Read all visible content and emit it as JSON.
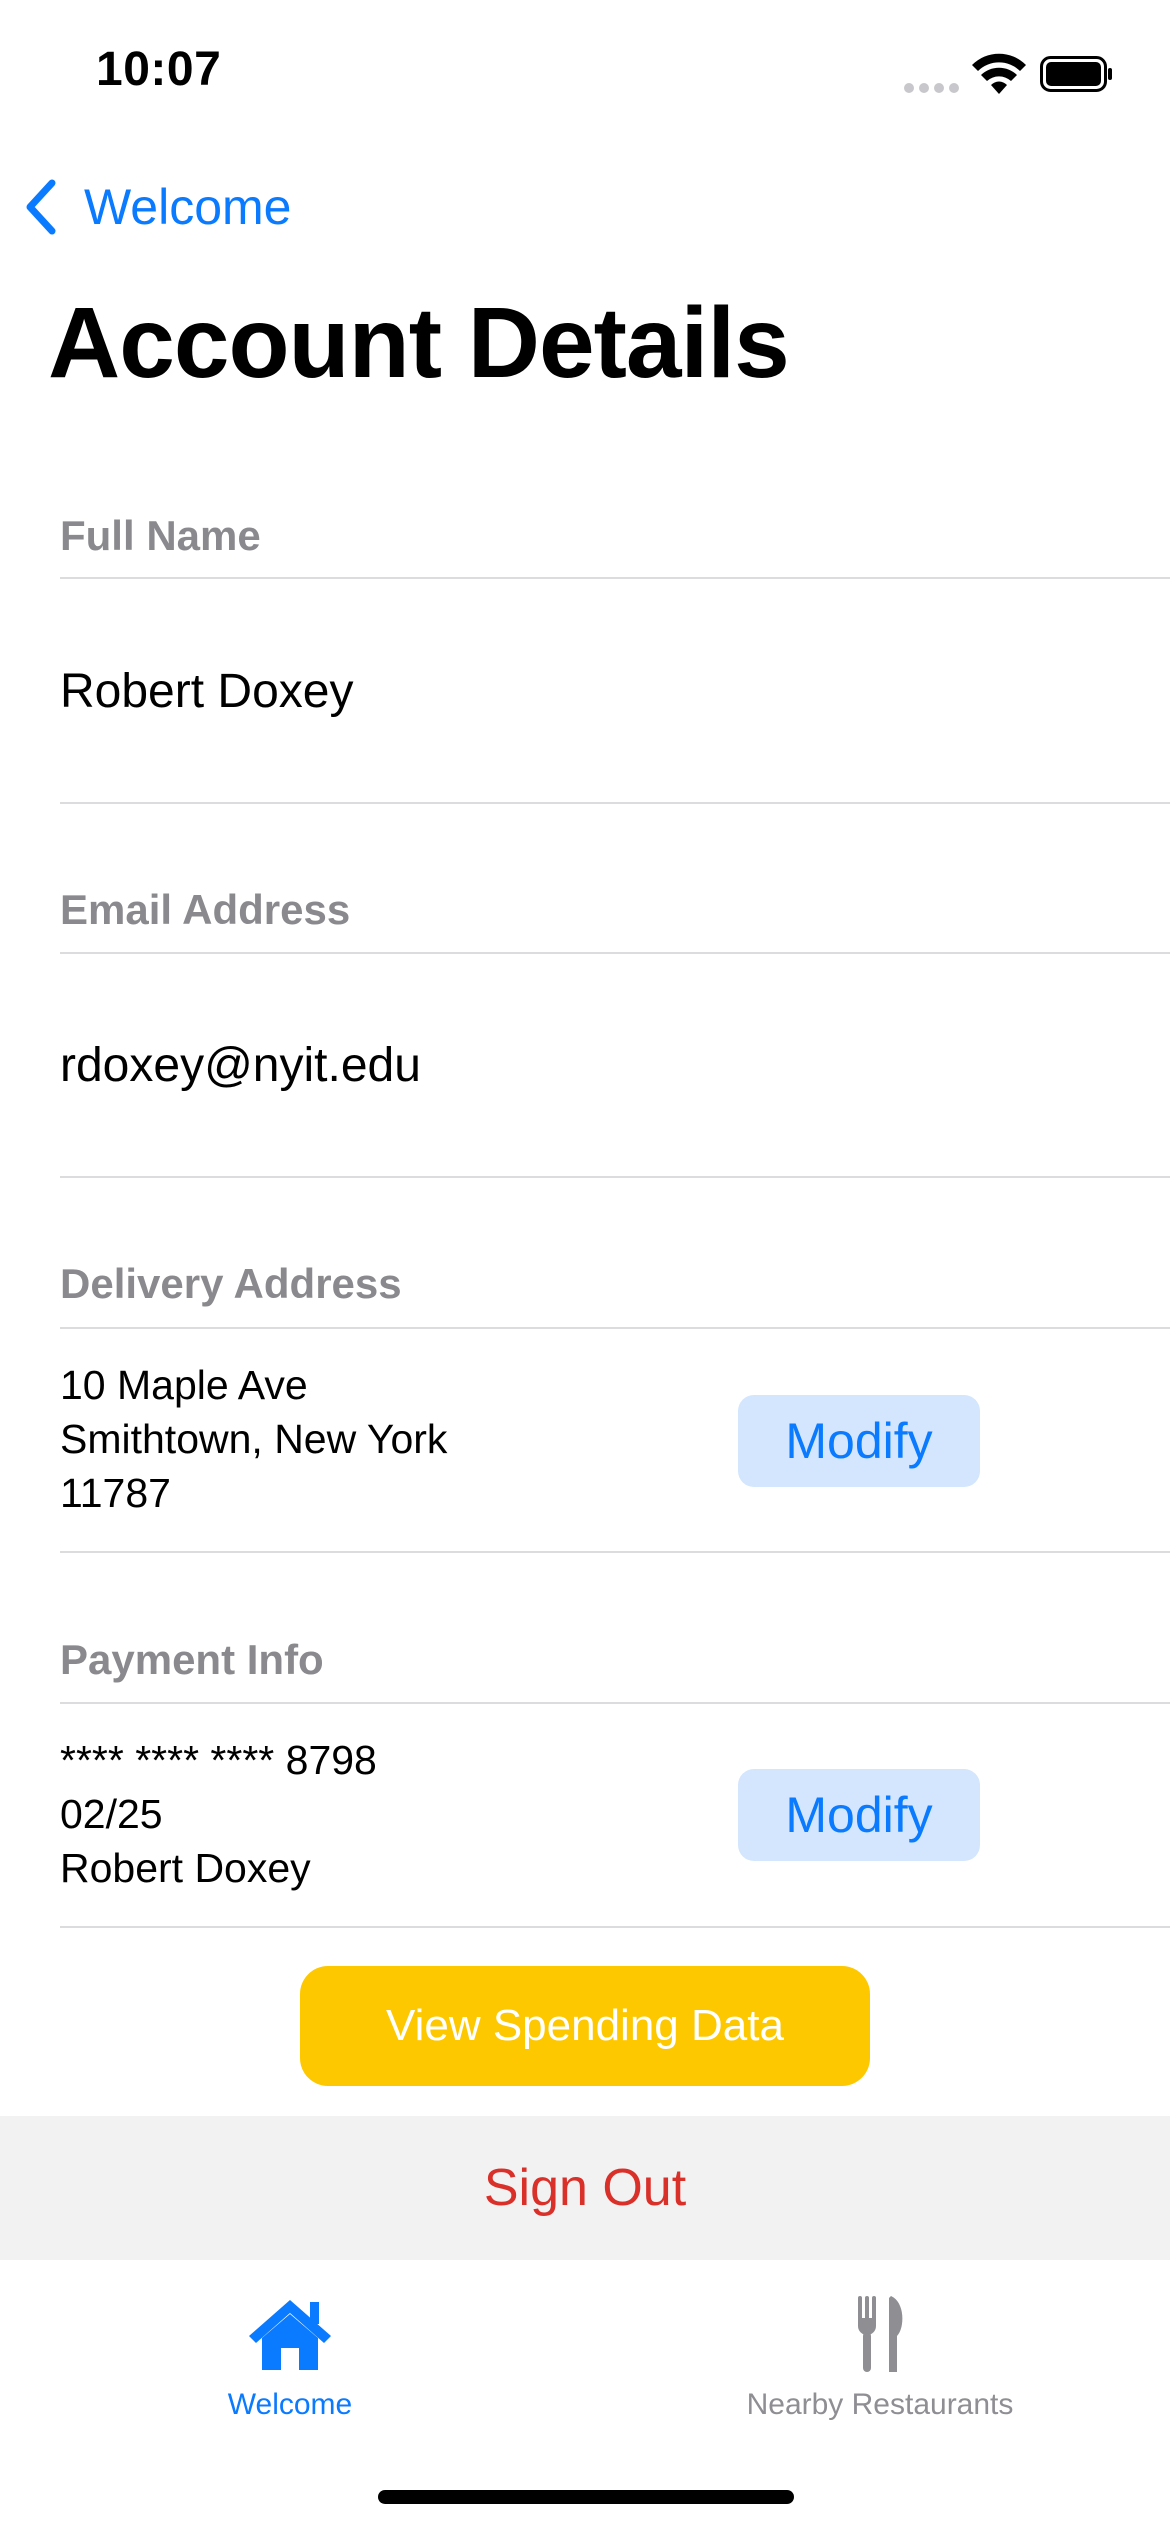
{
  "status_bar": {
    "time": "10:07"
  },
  "nav": {
    "back_label": "Welcome"
  },
  "page": {
    "title": "Account Details"
  },
  "sections": {
    "full_name": {
      "header": "Full Name",
      "value": "Robert Doxey"
    },
    "email": {
      "header": "Email Address",
      "value": "rdoxey@nyit.edu"
    },
    "delivery": {
      "header": "Delivery Address",
      "lines": [
        "10 Maple Ave",
        "Smithtown, New York",
        "11787"
      ],
      "button_label": "Modify"
    },
    "payment": {
      "header": "Payment Info",
      "lines": [
        "**** **** **** 8798",
        "02/25",
        "Robert Doxey"
      ],
      "button_label": "Modify"
    }
  },
  "actions": {
    "spending_label": "View Spending Data",
    "signout_label": "Sign Out"
  },
  "tab_bar": {
    "tabs": [
      {
        "label": "Welcome",
        "icon": "house-icon",
        "active": true
      },
      {
        "label": "Nearby Restaurants",
        "icon": "fork-knife-icon",
        "active": false
      }
    ]
  },
  "colors": {
    "accent": "#0a7aff",
    "header_gray": "#8a8a8e",
    "button_bg": "#d3e6fd",
    "yellow": "#fec800",
    "destructive": "#d9302a",
    "inactive_tab": "#8e8e93"
  }
}
